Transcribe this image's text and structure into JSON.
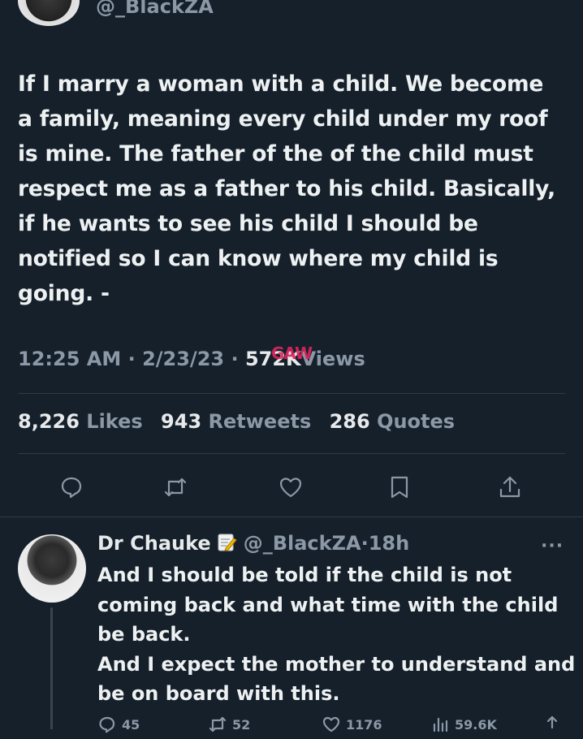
{
  "top": {
    "handle": "@_BlackZA"
  },
  "tweet": {
    "lines": [
      "If  I marry a woman with a child. We become",
      "a family, meaning every child under my roof",
      "is mine. The father of the of the child must",
      "respect me as a father to his child. Basically,",
      "if he wants to see his child I should be",
      "notified so I can know where my child is",
      "going. -"
    ],
    "time": "12:25 AM",
    "date": "2/23/23",
    "views_count": "572K",
    "views_label": "Views",
    "watermark": "GAW",
    "likes_count": "8,226",
    "likes_label": "Likes",
    "retweets_count": "943",
    "retweets_label": "Retweets",
    "quotes_count": "286",
    "quotes_label": "Quotes",
    "actions": [
      "reply-icon",
      "retweet-icon",
      "like-icon",
      "bookmark-icon",
      "share-icon"
    ]
  },
  "reply": {
    "name": "Dr Chauke",
    "handle": "@_BlackZA",
    "time": "18h",
    "more": "···",
    "lines": [
      "And I should be told if the child is not",
      "coming back and what time with the child",
      "be back.",
      "And I expect the mother to understand and",
      "be on board with this."
    ],
    "counts": {
      "replies": "45",
      "retweets": "52",
      "likes": "1176",
      "views": "59.6K"
    }
  },
  "colors": {
    "background": "#15202b",
    "text": "#e7e9ea",
    "muted": "#8b98a5",
    "watermark": "#e0245e"
  }
}
